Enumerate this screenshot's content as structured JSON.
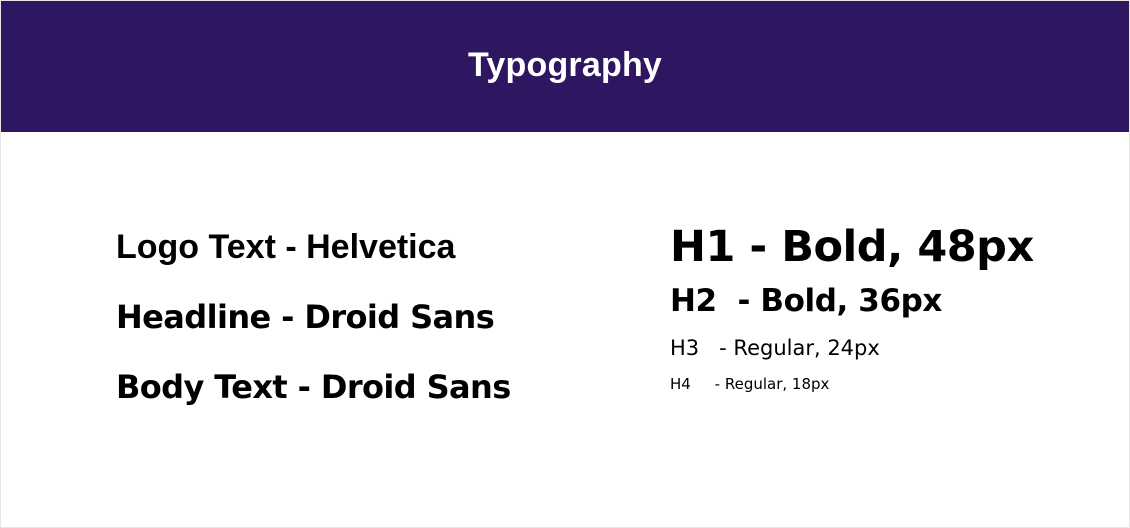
{
  "theme": {
    "header_bg": "#2e1760",
    "header_text": "#ffffff",
    "body_text": "#000000"
  },
  "header": {
    "title": "Typography"
  },
  "font_specs": [
    {
      "label": "Logo Text - Helvetica"
    },
    {
      "label": "Headline - Droid Sans"
    },
    {
      "label": "Body Text - Droid Sans"
    }
  ],
  "heading_specs": [
    {
      "label": "H1 - Bold, 48px"
    },
    {
      "label": "H2  - Bold, 36px"
    },
    {
      "label": "H3   - Regular, 24px"
    },
    {
      "label": "H4     - Regular, 18px"
    }
  ]
}
